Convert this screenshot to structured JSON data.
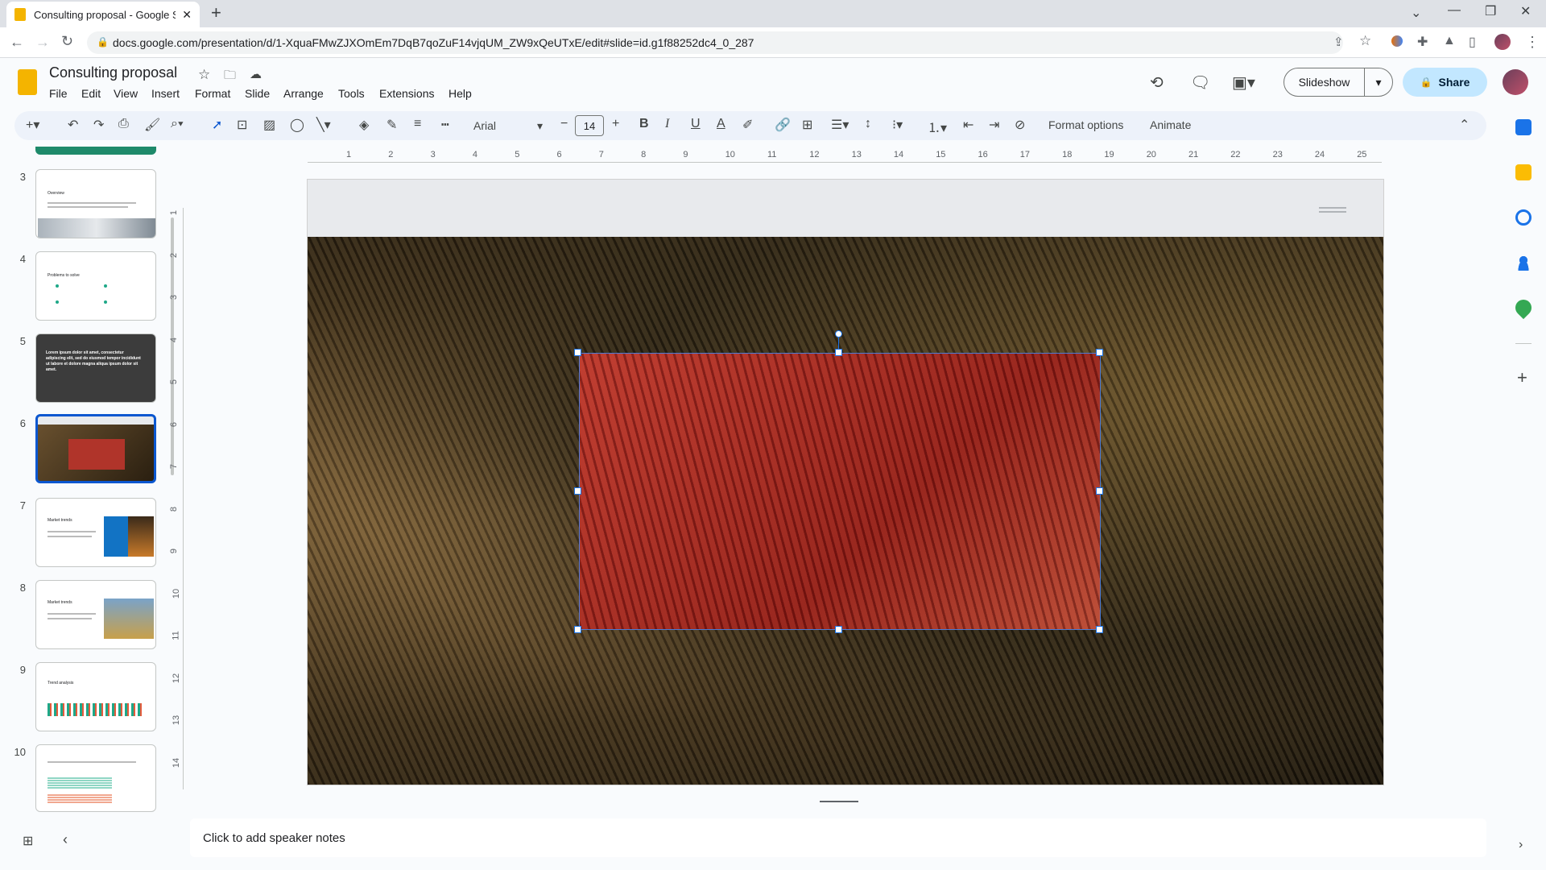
{
  "browser": {
    "tab_title": "Consulting proposal - Google Sli",
    "url": "docs.google.com/presentation/d/1-XquaFMwZJXOmEm7DqB7qoZuF14vjqUM_ZW9xQeUTxE/edit#slide=id.g1f88252dc4_0_287"
  },
  "doc": {
    "title": "Consulting proposal",
    "menus": [
      "File",
      "Edit",
      "View",
      "Insert",
      "Format",
      "Slide",
      "Arrange",
      "Tools",
      "Extensions",
      "Help"
    ],
    "slideshow_label": "Slideshow",
    "share_label": "Share"
  },
  "toolbar": {
    "font": "Arial",
    "font_size": "14",
    "format_options": "Format options",
    "animate": "Animate"
  },
  "filmstrip": {
    "numbers": [
      "3",
      "4",
      "5",
      "6",
      "7",
      "8",
      "9",
      "10"
    ],
    "selected": "6",
    "thumb_titles": {
      "3": "Overview",
      "4": "Problems to solve",
      "5": "Lorem ipsum dolor sit amet, consectetur adipiscing elit, sed do eiusmod tempor incididunt ut labore et dolore magna aliqua ipsum dolor sit amet.",
      "7": "Market trends",
      "8": "Market trends",
      "9": "Trend analysis"
    }
  },
  "ruler": {
    "h": [
      "1",
      "2",
      "3",
      "4",
      "5",
      "6",
      "7",
      "8",
      "9",
      "10",
      "11",
      "12",
      "13",
      "14",
      "15",
      "16",
      "17",
      "18",
      "19",
      "20",
      "21",
      "22",
      "23",
      "24",
      "25"
    ],
    "v": [
      "1",
      "2",
      "3",
      "4",
      "5",
      "6",
      "7",
      "8",
      "9",
      "10",
      "11",
      "12",
      "13",
      "14"
    ]
  },
  "notes": {
    "placeholder": "Click to add speaker notes"
  },
  "colors": {
    "accent": "#1a73e8",
    "share_bg": "#c2e7ff",
    "shape_fill": "#a52a22"
  }
}
